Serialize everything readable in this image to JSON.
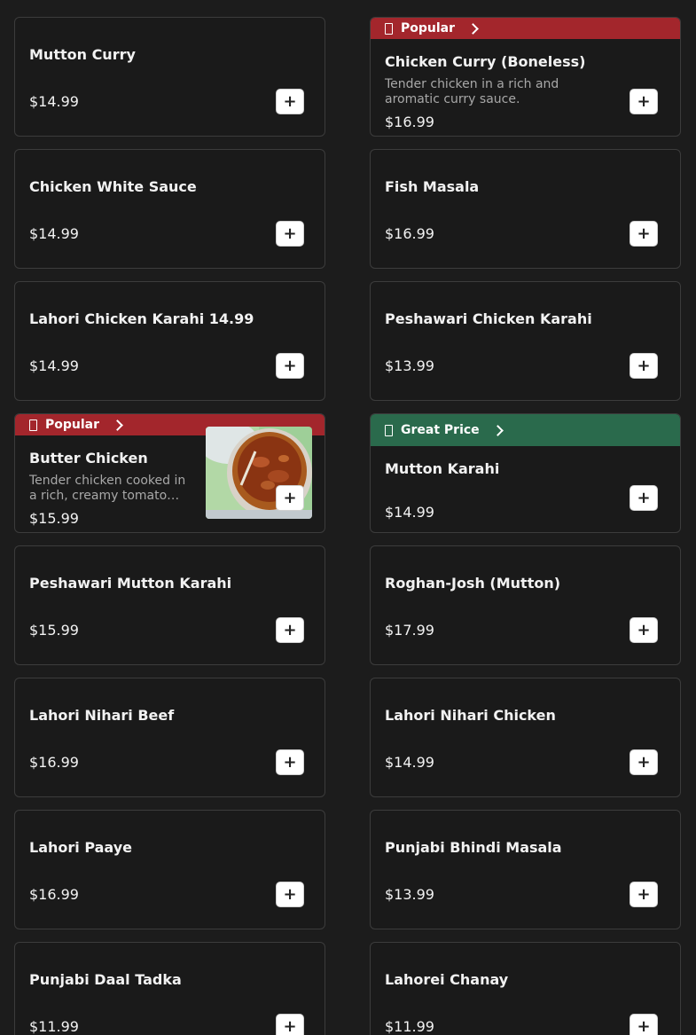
{
  "menu_items": [
    {
      "name": "Mutton Curry",
      "price": "$14.99",
      "add_label": "+"
    },
    {
      "badge": "Popular",
      "name": "Chicken Curry (Boneless)",
      "description": "Tender chicken in a rich and aromatic curry sauce.",
      "price": "$16.99",
      "add_label": "+"
    },
    {
      "name": "Chicken White Sauce",
      "price": "$14.99",
      "add_label": "+"
    },
    {
      "name": "Fish Masala",
      "price": "$16.99",
      "add_label": "+"
    },
    {
      "name": "Lahori Chicken Karahi 14.99",
      "price": "$14.99",
      "add_label": "+"
    },
    {
      "name": "Peshawari Chicken Karahi",
      "price": "$13.99",
      "add_label": "+"
    },
    {
      "badge": "Popular",
      "name": "Butter Chicken",
      "description": "Tender chicken cooked in a rich, creamy tomato…",
      "price": "$15.99",
      "add_label": "+",
      "image": "butter-chicken-photo"
    },
    {
      "badge": "Great Price",
      "name": "Mutton Karahi",
      "price": "$14.99",
      "add_label": "+"
    },
    {
      "name": "Peshawari Mutton Karahi",
      "price": "$15.99",
      "add_label": "+"
    },
    {
      "name": "Roghan-Josh (Mutton)",
      "price": "$17.99",
      "add_label": "+"
    },
    {
      "name": "Lahori Nihari Beef",
      "price": "$16.99",
      "add_label": "+"
    },
    {
      "name": "Lahori Nihari Chicken",
      "price": "$14.99",
      "add_label": "+"
    },
    {
      "name": "Lahori Paaye",
      "price": "$16.99",
      "add_label": "+"
    },
    {
      "name": "Punjabi Bhindi Masala",
      "price": "$13.99",
      "add_label": "+"
    },
    {
      "name": "Punjabi Daal Tadka",
      "price": "$11.99",
      "add_label": "+"
    },
    {
      "name": "Lahorei Chanay",
      "price": "$11.99",
      "add_label": "+"
    }
  ],
  "colors": {
    "background": "#1c1c1c",
    "card": "#1a1a1a",
    "popular_banner": "#a3262c",
    "great_price_banner": "#2a6a4c"
  }
}
